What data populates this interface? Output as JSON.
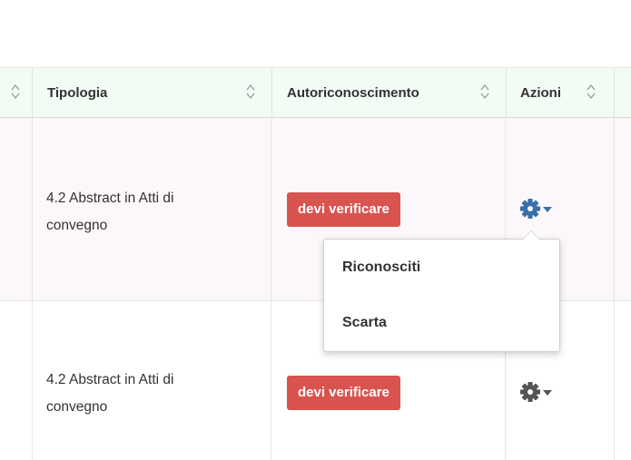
{
  "table": {
    "columns": [
      {
        "label": ""
      },
      {
        "label": "Tipologia"
      },
      {
        "label": "Autoriconoscimento"
      },
      {
        "label": "Azioni"
      }
    ],
    "rows": [
      {
        "tipologia_line1": "4.2 Abstract in Atti di",
        "tipologia_line2": "convegno",
        "status": "devi verificare",
        "actions_icon": "gear-icon"
      },
      {
        "tipologia_line1": "4.2 Abstract in Atti di",
        "tipologia_line2": "convegno",
        "status": "devi verificare",
        "actions_icon": "gear-icon"
      }
    ]
  },
  "dropdown": {
    "items": [
      {
        "label": "Riconosciti"
      },
      {
        "label": "Scarta"
      }
    ]
  },
  "colors": {
    "header_bg": "#f3fbf5",
    "row_highlight_bg": "#fcf7fb",
    "badge_bg": "#d9534f",
    "gear_active": "#3a6fa8",
    "gear_default": "#555555"
  }
}
